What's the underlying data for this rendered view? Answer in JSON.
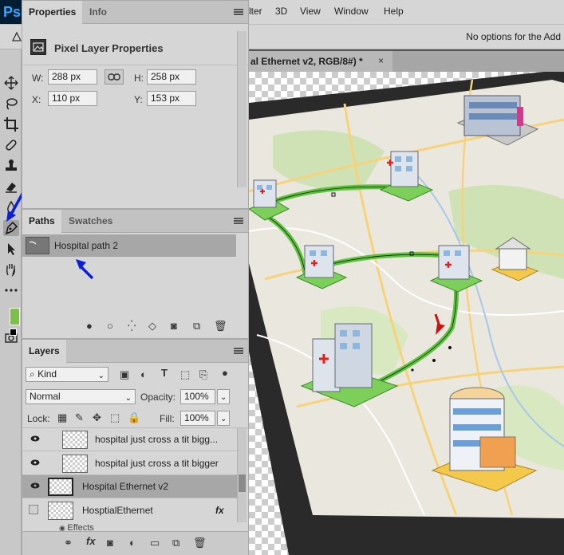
{
  "app": {
    "logo": "Ps"
  },
  "menu": [
    "lter",
    "3D",
    "View",
    "Window",
    "Help"
  ],
  "options_bar": {
    "text": "No options for the Add"
  },
  "document": {
    "tab_title": "al Ethernet v2, RGB/8#) *",
    "close": "×"
  },
  "properties_panel": {
    "tabs": [
      "Properties",
      "Info"
    ],
    "title": "Pixel Layer Properties",
    "w_label": "W:",
    "w_value": "288 px",
    "h_label": "H:",
    "h_value": "258 px",
    "x_label": "X:",
    "x_value": "110 px",
    "y_label": "Y:",
    "y_value": "153 px"
  },
  "paths_panel": {
    "tabs": [
      "Paths",
      "Swatches"
    ],
    "items": [
      {
        "name": "Hospital path 2"
      }
    ]
  },
  "layers_panel": {
    "tab": "Layers",
    "filter_label": "Kind",
    "blend_mode": "Normal",
    "opacity_label": "Opacity:",
    "opacity_value": "100%",
    "lock_label": "Lock:",
    "fill_label": "Fill:",
    "fill_value": "100%",
    "layers": [
      {
        "name": "hospital just cross a tit bigg...",
        "visible": true
      },
      {
        "name": "hospital just cross a tit bigger",
        "visible": true
      },
      {
        "name": "Hospital Ethernet v2",
        "visible": true,
        "selected": true
      },
      {
        "name": "HosptialEthernet",
        "visible": false,
        "fx": "fx"
      }
    ],
    "effects_label": "Effects",
    "footer_fx": "fx"
  },
  "colors": {
    "foreground": "#7cc04a",
    "route": "#5cc43a",
    "annotation_arrow": "#0a1fd6",
    "map_arrow": "#cc1111"
  }
}
